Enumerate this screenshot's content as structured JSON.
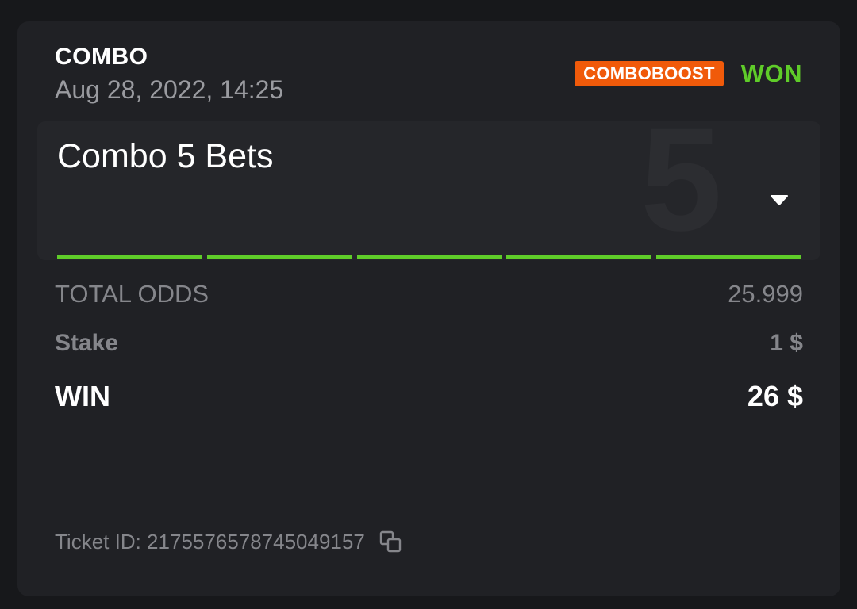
{
  "bet": {
    "type": "COMBO",
    "date": "Aug 28, 2022, 14:25",
    "boost_badge": "COMBOBOOST",
    "status": "WON"
  },
  "combo": {
    "title": "Combo 5 Bets",
    "count": "5",
    "legs_won": 5,
    "legs_total": 5,
    "toggle_icon": "caret-down-icon"
  },
  "summary": {
    "odds_label": "TOTAL ODDS",
    "odds_value": "25.999",
    "stake_label": "Stake",
    "stake_value": "1 $",
    "win_label": "WIN",
    "win_value": "26 $"
  },
  "ticket": {
    "label": "Ticket ID: 2175576578745049157",
    "copy_icon": "copy-icon"
  },
  "colors": {
    "background": "#17181b",
    "card": "#202125",
    "panel": "#25262a",
    "accent_won": "#5fcc29",
    "boost": "#f05a0a"
  }
}
